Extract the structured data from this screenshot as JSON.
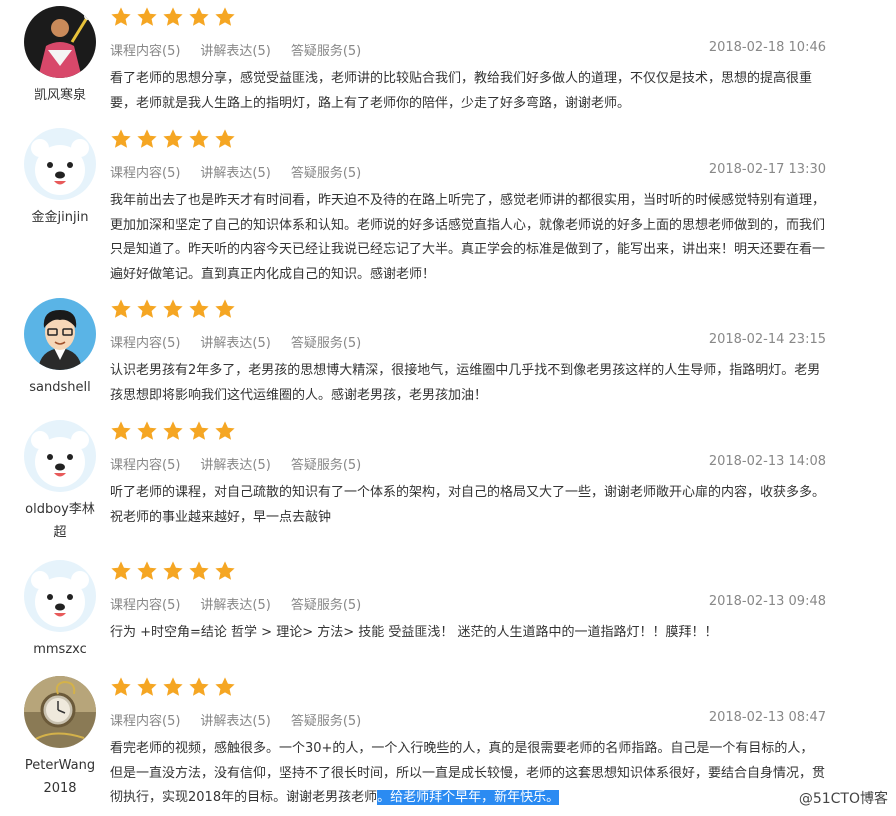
{
  "score_labels": [
    "课程内容(5)",
    "讲解表达(5)",
    "答疑服务(5)"
  ],
  "reviews": [
    {
      "user": "凯风寒泉",
      "avatar": "badminton-player-photo",
      "rating": 5,
      "date": "2018-02-18 10:46",
      "text": "看了老师的思想分享，感觉受益匪浅，老师讲的比较贴合我们，教给我们好多做人的道理，不仅仅是技术，思想的提高很重要，老师就是我人生路上的指明灯，路上有了老师你的陪伴，少走了好多弯路，谢谢老师。",
      "highlight": ""
    },
    {
      "user": "金金jinjin",
      "avatar": "default-bear",
      "rating": 5,
      "date": "2018-02-17 13:30",
      "text": "我年前出去了也是昨天才有时间看，昨天迫不及待的在路上听完了，感觉老师讲的都很实用，当时听的时候感觉特别有道理，更加加深和坚定了自己的知识体系和认知。老师说的好多话感觉直指人心，就像老师说的好多上面的思想老师做到的，而我们只是知道了。昨天听的内容今天已经让我说已经忘记了大半。真正学会的标准是做到了，能写出来，讲出来！明天还要在看一遍好好做笔记。直到真正内化成自己的知识。感谢老师！",
      "highlight": ""
    },
    {
      "user": "sandshell",
      "avatar": "cartoon-man-glasses",
      "rating": 5,
      "date": "2018-02-14 23:15",
      "text": "认识老男孩有2年多了，老男孩的思想博大精深，很接地气，运维圈中几乎找不到像老男孩这样的人生导师，指路明灯。老男孩思想即将影响我们这代运维圈的人。感谢老男孩，老男孩加油！",
      "highlight": ""
    },
    {
      "user": "oldboy李林超",
      "avatar": "default-bear",
      "rating": 5,
      "date": "2018-02-13 14:08",
      "text": "听了老师的课程，对自己疏散的知识有了一个体系的架构，对自己的格局又大了一些，谢谢老师敞开心扉的内容，收获多多。祝老师的事业越来越好，早一点去敲钟",
      "highlight": ""
    },
    {
      "user": "mmszxc",
      "avatar": "default-bear",
      "rating": 5,
      "date": "2018-02-13 09:48",
      "text": "行为 +时空角=结论 哲学 > 理论> 方法> 技能 受益匪浅！ 迷茫的人生道路中的一道指路灯！！膜拜！！",
      "highlight": ""
    },
    {
      "user": "PeterWang2018",
      "avatar": "pocket-watch-photo",
      "rating": 5,
      "date": "2018-02-13 08:47",
      "text": "看完老师的视频，感触很多。一个30+的人，一个入行晚些的人，真的是很需要老师的名师指路。自己是一个有目标的人，但是一直没方法，没有信仰，坚持不了很长时间，所以一直是成长较慢，老师的这套思想知识体系很好，要结合自身情况，贯彻执行，实现2018年的目标。谢谢老男孩老师",
      "highlight": "。给老师拜个早年，新年快乐。"
    }
  ],
  "watermark": "@51CTO博客",
  "colors": {
    "star": "#f5a623",
    "highlight": "#2b8bf2",
    "meta": "#888888"
  }
}
